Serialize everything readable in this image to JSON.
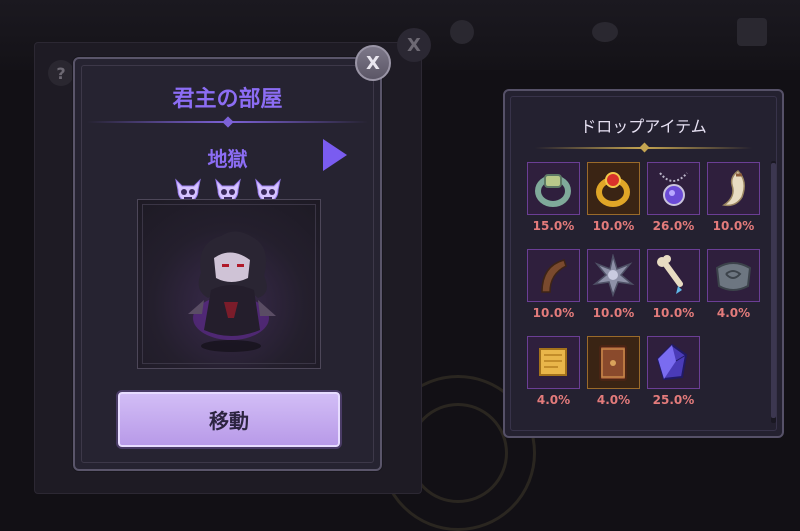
{
  "modal": {
    "title": "君主の部屋",
    "difficulty": "地獄",
    "skull_count": 3,
    "move_label": "移動",
    "close_label": "X"
  },
  "back_panel": {
    "close_label": "X",
    "help_label": "?"
  },
  "drops": {
    "title": "ドロップアイテム",
    "items": [
      {
        "icon": "ring-icon",
        "rate": "15.0%"
      },
      {
        "icon": "gold-ring-icon",
        "rate": "10.0%"
      },
      {
        "icon": "amulet-icon",
        "rate": "26.0%"
      },
      {
        "icon": "horn-icon",
        "rate": "10.0%"
      },
      {
        "icon": "claw-icon",
        "rate": "10.0%"
      },
      {
        "icon": "spike-orb-icon",
        "rate": "10.0%"
      },
      {
        "icon": "bone-icon",
        "rate": "10.0%"
      },
      {
        "icon": "stone-tablet-icon",
        "rate": "4.0%"
      },
      {
        "icon": "scroll-icon",
        "rate": "4.0%"
      },
      {
        "icon": "book-icon",
        "rate": "4.0%"
      },
      {
        "icon": "crystal-icon",
        "rate": "25.0%"
      }
    ]
  },
  "colors": {
    "accent": "#8c6df4",
    "rate": "#e37b7b",
    "button": "#c9b2f3"
  }
}
